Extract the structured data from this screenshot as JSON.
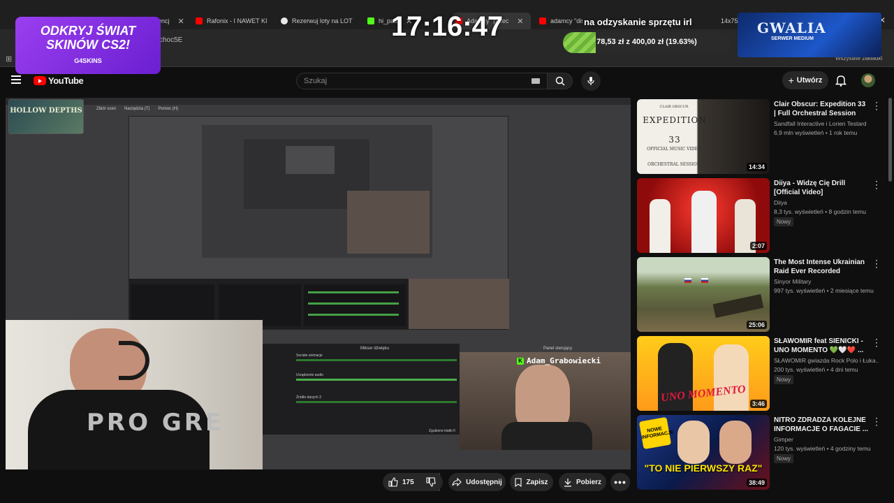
{
  "browser": {
    "tabs": [
      {
        "label": "encj",
        "color": "#ff0000"
      },
      {
        "label": "Rafonix - I NAWET KI",
        "color": "#ff0000"
      },
      {
        "label": "Rezerwuj loty na LOT",
        "color": "#e8e8e8"
      },
      {
        "label": "hi_patt",
        "color": "#53fc18"
      },
      {
        "label": "Adamcy \"przec",
        "color": "#ff0000"
      },
      {
        "label": "adamcy \"diss\"",
        "color": "#ff0000"
      },
      {
        "label": "14x75",
        "color": "#4caf50"
      }
    ],
    "address_fragment": "choc5E",
    "bookmarks_label": "Wszystkie zakładki"
  },
  "overlay": {
    "promo_line1": "ODKRYJ ŚWIAT",
    "promo_line2": "SKINÓW CS2!",
    "promo_brand": "G4SKINS",
    "clock": "17:16:47",
    "goal_title": "na odzyskanie sprzętu irl",
    "goal_progress": "78,53 zł z 400,00 zł (19.63%)",
    "goal_fraction": 0.1963,
    "gwalia_title": "GWALIA",
    "gwalia_sub": "SERWER MEDIUM",
    "hollow_title": "HOLLOW DEPTHS",
    "stream_name": "Adam_Grabowiecki",
    "obs_menu": [
      "Zbiór scen",
      "Narzędzia (T)",
      "Pomoc (H)"
    ],
    "mixer_title": "Mikser dźwięku",
    "panel_title": "Panel sterujący",
    "mixer_rows": [
      "Sociale animacje",
      "Urządzenie audio",
      "Źródło danych 3"
    ],
    "dropped_frames": "Zgubione klatki 0",
    "shirt_text": "PRO GRE"
  },
  "youtube": {
    "logo": "YouTube",
    "search_placeholder": "Szukaj",
    "create_label": "Utwórz",
    "actions": {
      "likes": "175",
      "share": "Udostępnij",
      "save": "Zapisz",
      "download": "Pobierz"
    },
    "recommendations": [
      {
        "title": "Clair Obscur: Expedition 33 | Full Orchestral Session [Officia...",
        "channel": "Sandfall Interactive i Lorien Testard",
        "meta": "6,9 mln wyświetleń • 1 rok temu",
        "badge": "",
        "duration": "14:34",
        "thumb_text": "EXPEDITION 33",
        "thumb_sub": "OFFICIAL MUSIC VIDEO",
        "thumb_sub2": "ORCHESTRAL SESSION",
        "thumb_top": "CLAIR OBSCUR"
      },
      {
        "title": "Diiya - Widzę Cię Drill [Official Video]",
        "channel": "Diiya",
        "meta": "8,3 tys. wyświetleń • 8 godzin temu",
        "badge": "Nowy",
        "duration": "2:07"
      },
      {
        "title": "The Most Intense Ukrainian Raid Ever Recorded",
        "channel": "Sinyor Military",
        "meta": "997 tys. wyświetleń • 2 miesiące temu",
        "badge": "",
        "duration": "25:06"
      },
      {
        "title": "SŁAWOMIR feat SIENICKI - UNO MOMENTO 💚🤍❤️ ...",
        "channel": "SŁAWOMIR gwiazda Rock Polo i Łuka...",
        "meta": "200 tys. wyświetleń • 4 dni temu",
        "badge": "Nowy",
        "duration": "3:46",
        "thumb_text": "UNO MOMENTO"
      },
      {
        "title": "NITRO ZDRADZA KOLEJNE INFORMACJE O FAGACIE ...",
        "channel": "Gimper",
        "meta": "120 tys. wyświetleń • 4 godziny temu",
        "badge": "Nowy",
        "duration": "38:49",
        "thumb_text": "\"TO NIE PIERWSZY RAZ\"",
        "thumb_sub": "NOWE INFORMACJE"
      }
    ]
  },
  "colors": {
    "yt_red": "#ff0000",
    "goal_green": "#7ac943",
    "promo_purple": "#7b2ff7",
    "kick_green": "#53fc18"
  }
}
